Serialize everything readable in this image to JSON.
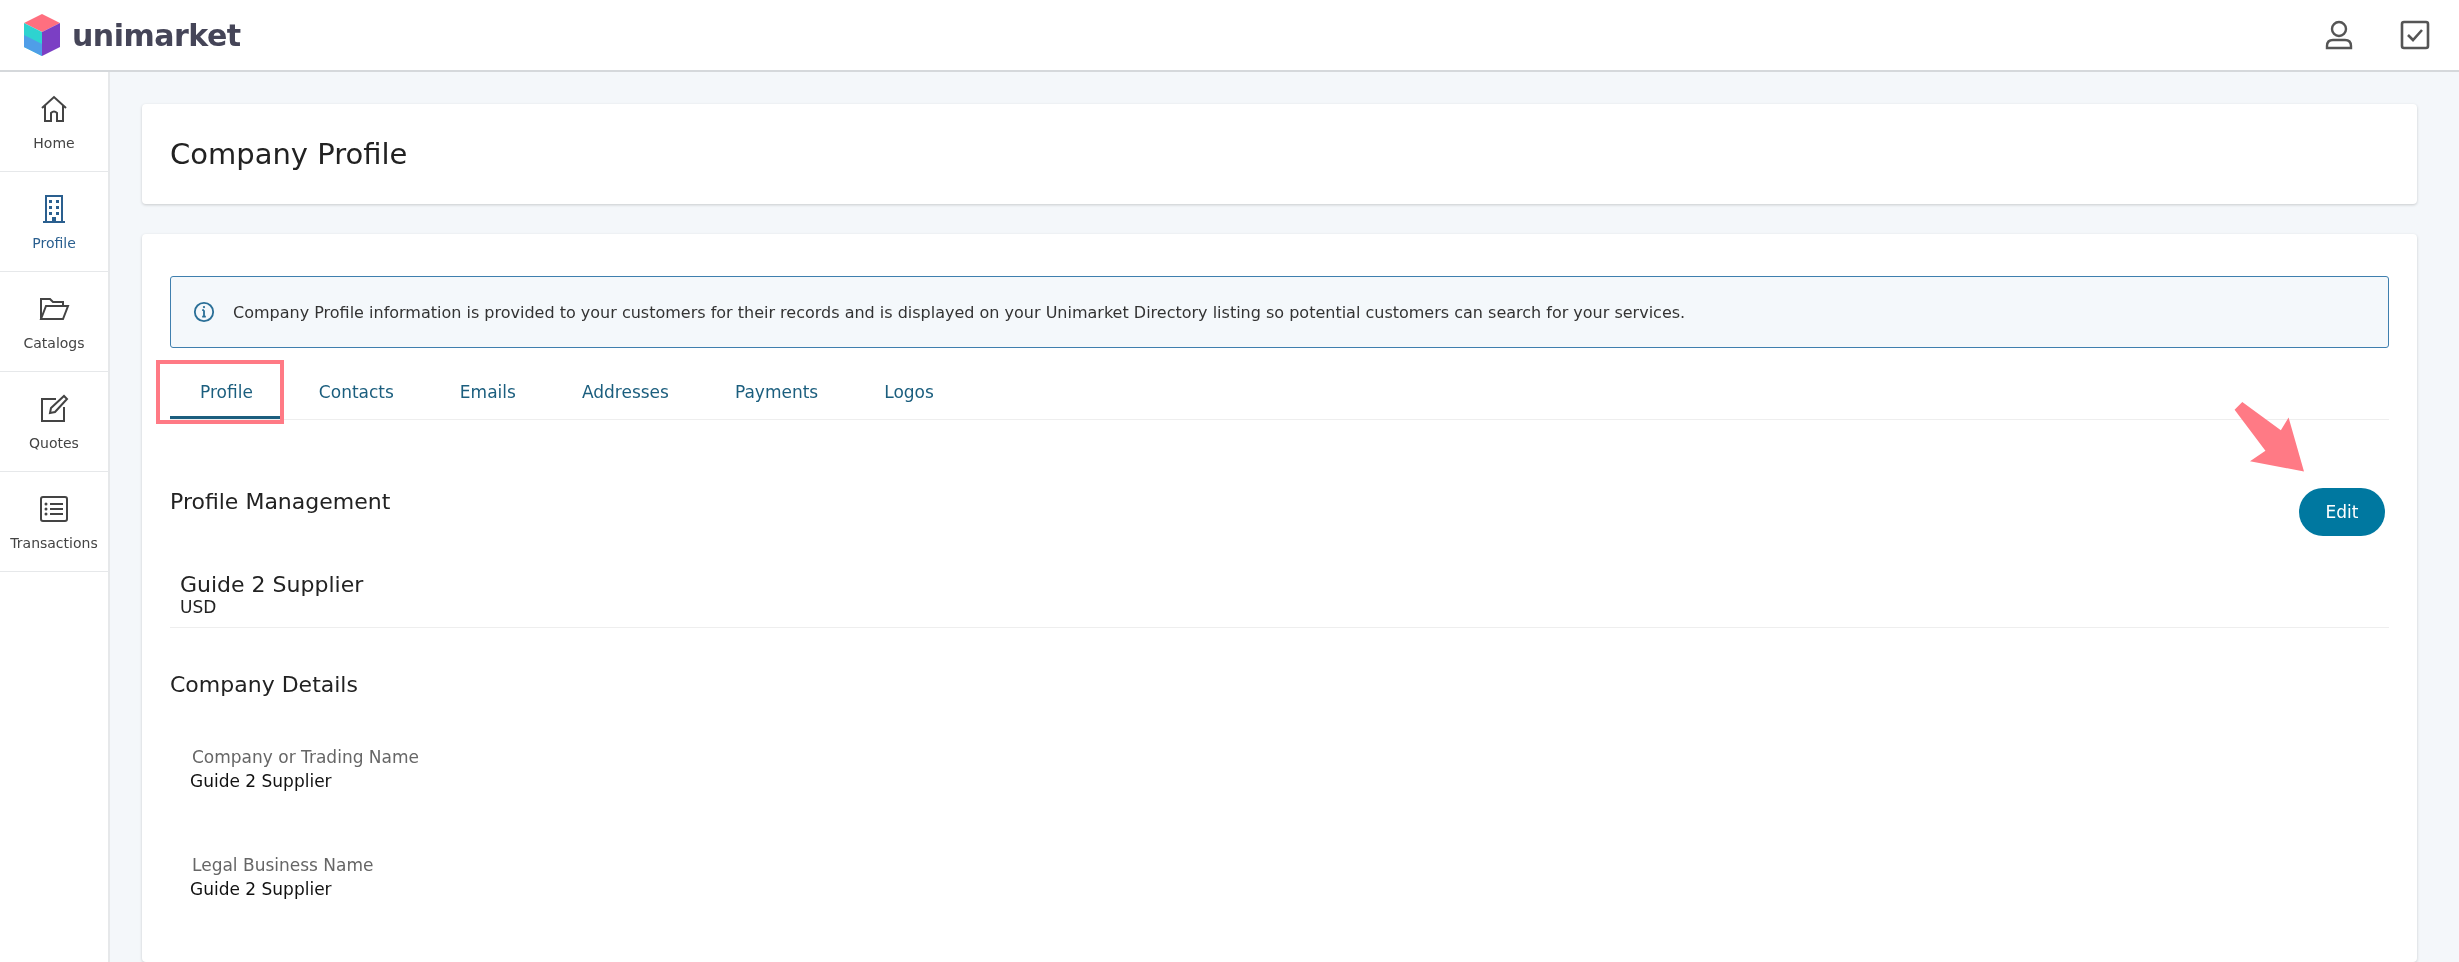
{
  "header": {
    "logo_text": "unimarket"
  },
  "sidebar": {
    "items": [
      {
        "label": "Home",
        "selected": false
      },
      {
        "label": "Profile",
        "selected": true
      },
      {
        "label": "Catalogs",
        "selected": false
      },
      {
        "label": "Quotes",
        "selected": false
      },
      {
        "label": "Transactions",
        "selected": false
      }
    ]
  },
  "page": {
    "title": "Company Profile"
  },
  "info_banner": {
    "text": "Company Profile information is provided to your customers for their records and is displayed on your Unimarket Directory listing so potential customers can search for your services."
  },
  "tabs": [
    {
      "label": "Profile",
      "selected": true
    },
    {
      "label": "Contacts",
      "selected": false
    },
    {
      "label": "Emails",
      "selected": false
    },
    {
      "label": "Addresses",
      "selected": false
    },
    {
      "label": "Payments",
      "selected": false
    },
    {
      "label": "Logos",
      "selected": false
    }
  ],
  "profile_management": {
    "heading": "Profile Management",
    "button": "Edit",
    "name": "Guide 2 Supplier",
    "currency": "USD"
  },
  "company_details": {
    "heading": "Company Details",
    "fields": [
      {
        "label": "Company or Trading Name",
        "value": "Guide 2 Supplier"
      },
      {
        "label": "Legal Business Name",
        "value": "Guide 2 Supplier"
      }
    ]
  }
}
